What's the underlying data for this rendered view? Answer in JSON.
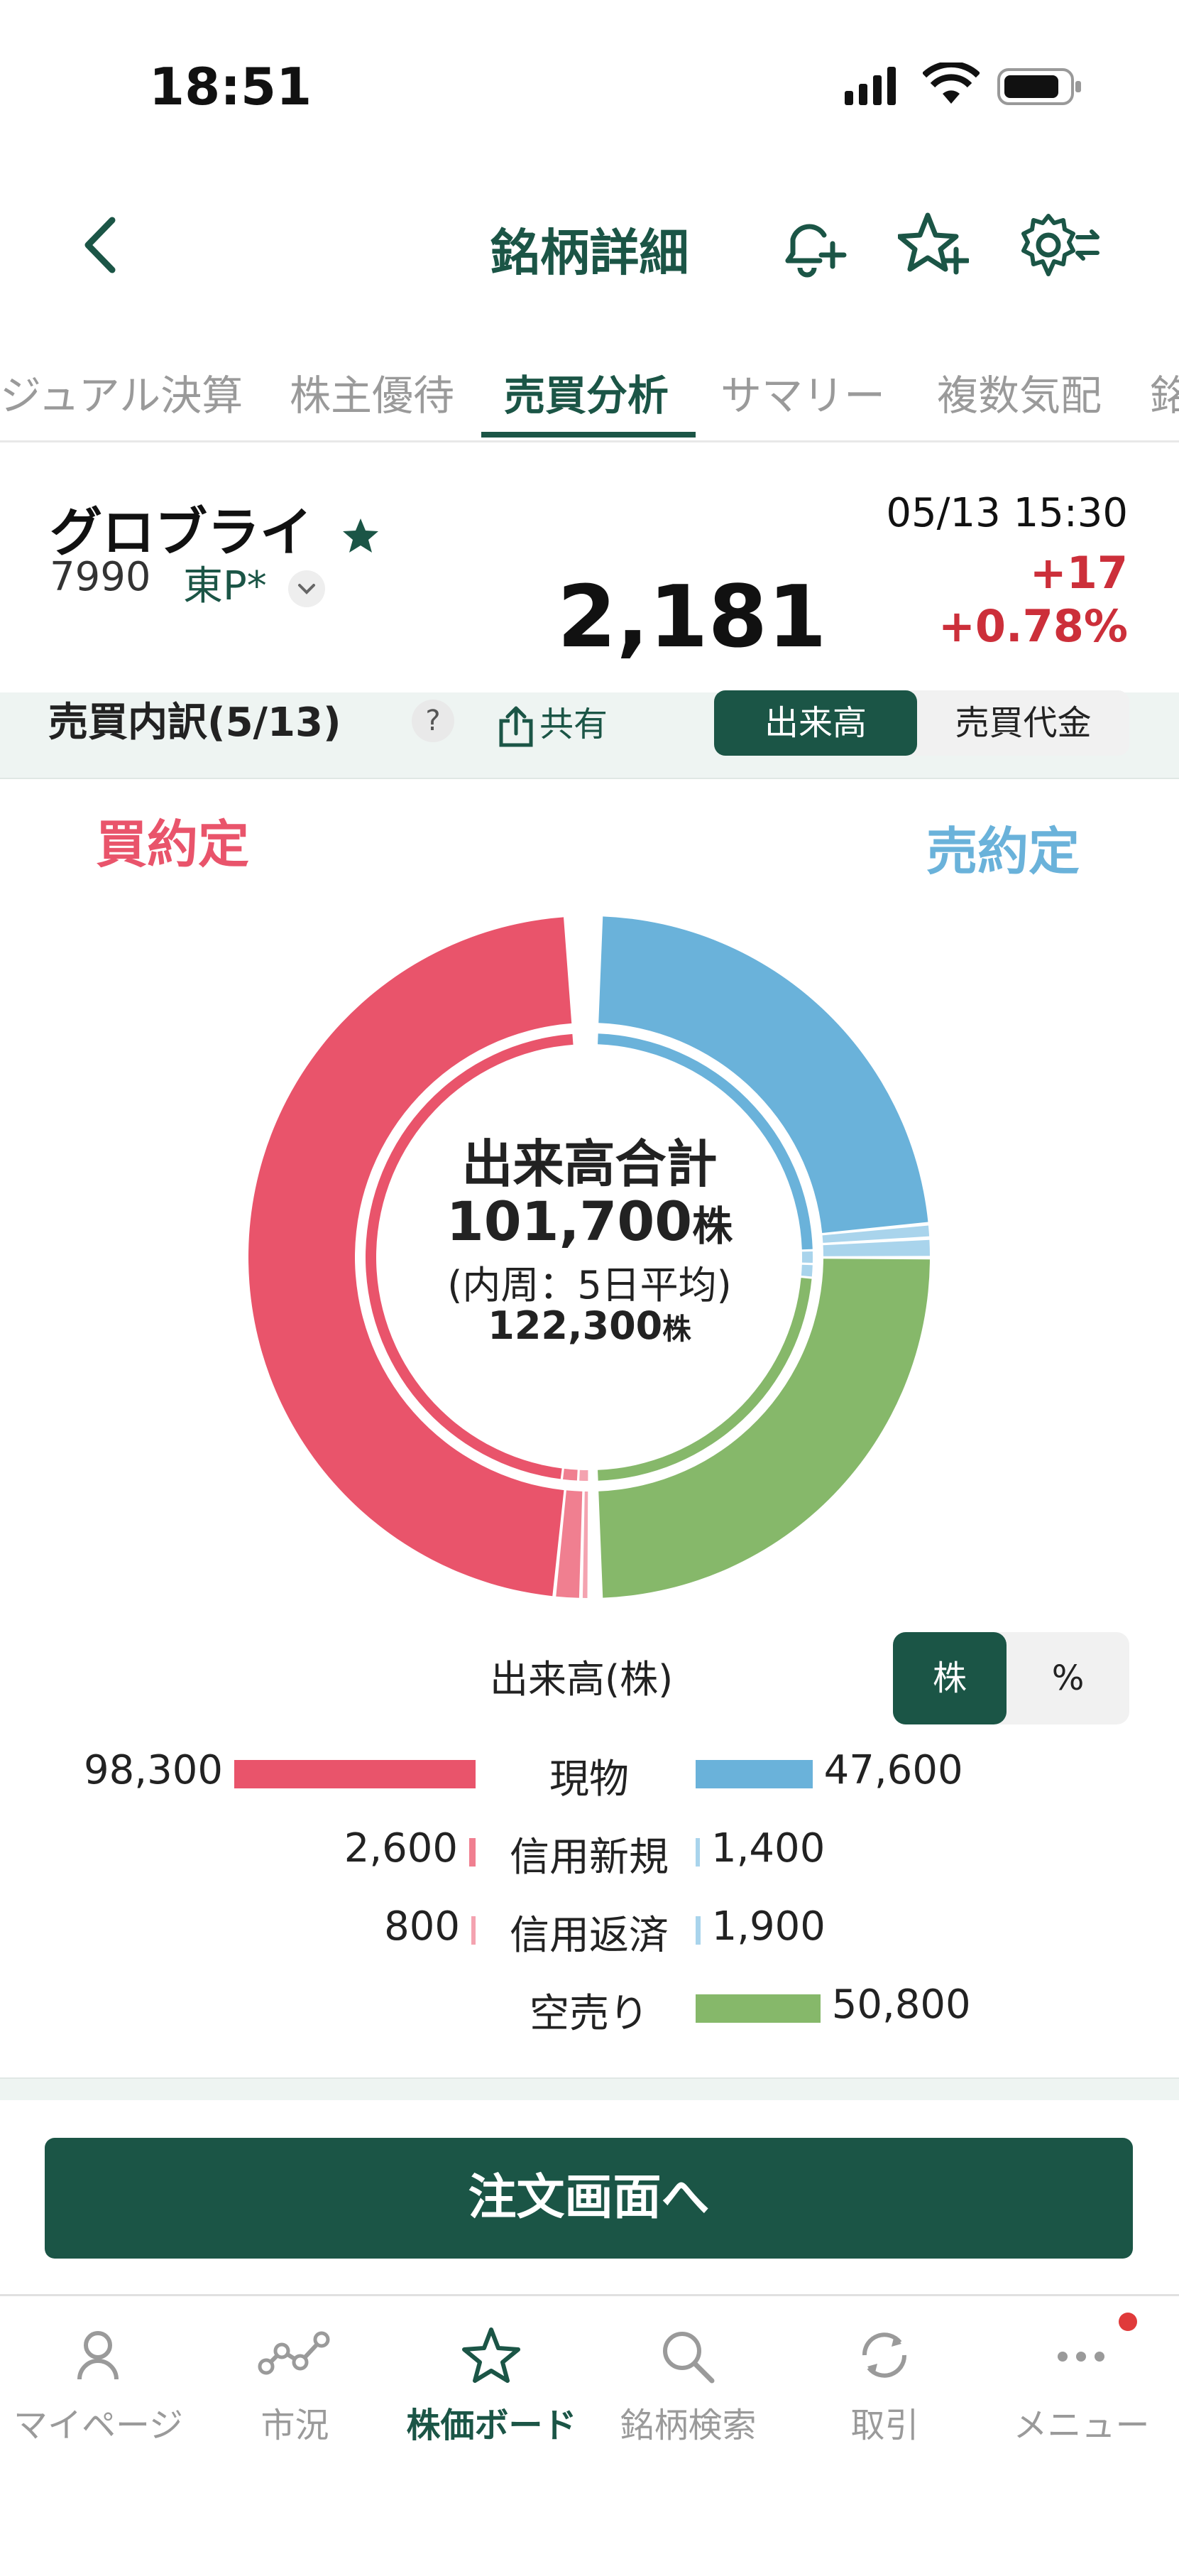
{
  "status_bar": {
    "time": "18:51"
  },
  "header": {
    "title": "銘柄詳細",
    "icons": [
      "back-chevron-icon",
      "bell-plus-icon",
      "star-plus-icon",
      "gear-swap-icon"
    ]
  },
  "tabs": [
    {
      "label": "ジュアル決算",
      "active": false
    },
    {
      "label": "株主優待",
      "active": false
    },
    {
      "label": "売買分析",
      "active": true
    },
    {
      "label": "サマリー",
      "active": false
    },
    {
      "label": "複数気配",
      "active": false
    },
    {
      "label": "銘",
      "active": false
    }
  ],
  "stock": {
    "name": "グロブライ",
    "code": "7990",
    "market": "東P*",
    "datetime": "05/13 15:30",
    "price": "2,181",
    "change": "+17",
    "change_pct": "+0.78%"
  },
  "section": {
    "title": "売買内訳(5/13)",
    "help": "?",
    "share": "共有",
    "toggle": [
      "出来高",
      "売買代金"
    ],
    "toggle_active": "出来高"
  },
  "chart_data": {
    "type": "pie",
    "buy_label": "買約定",
    "sell_label": "売約定",
    "center": {
      "title": "出来高合計",
      "total": "101,700",
      "unit": "株",
      "sub": "(内周：5日平均)",
      "avg": "122,300"
    },
    "outer_slices": [
      {
        "name": "現物",
        "side": "sell",
        "value": 47600,
        "color": "#6ab2da"
      },
      {
        "name": "信用新規",
        "side": "sell",
        "value": 1400,
        "color": "#a9d4ec"
      },
      {
        "name": "信用返済",
        "side": "sell",
        "value": 1900,
        "color": "#a9d4ec"
      },
      {
        "name": "空売り",
        "side": "sell",
        "value": 50800,
        "color": "#86b86a"
      },
      {
        "name": "信用返済",
        "side": "buy",
        "value": 800,
        "color": "#f4a3b0"
      },
      {
        "name": "信用新規",
        "side": "buy",
        "value": 2600,
        "color": "#f07f90"
      },
      {
        "name": "現物",
        "side": "buy",
        "value": 98300,
        "color": "#e9546b"
      }
    ]
  },
  "legend": {
    "title": "出来高(株)",
    "unit_toggle": [
      "株",
      "%"
    ],
    "unit_active": "株",
    "rows": [
      {
        "label": "現物",
        "buy": "98,300",
        "sell": "47,600",
        "buy_value": 98300,
        "sell_value": 47600
      },
      {
        "label": "信用新規",
        "buy": "2,600",
        "sell": "1,400",
        "buy_value": 2600,
        "sell_value": 1400
      },
      {
        "label": "信用返済",
        "buy": "800",
        "sell": "1,900",
        "buy_value": 800,
        "sell_value": 1900
      },
      {
        "label": "空売り",
        "buy": "",
        "sell": "50,800",
        "buy_value": 0,
        "sell_value": 50800
      }
    ]
  },
  "order_button": "注文画面へ",
  "bottom_nav": [
    {
      "label": "マイページ",
      "icon": "person-icon",
      "active": false
    },
    {
      "label": "市況",
      "icon": "chart-line-icon",
      "active": false
    },
    {
      "label": "株価ボード",
      "icon": "star-icon",
      "active": true
    },
    {
      "label": "銘柄検索",
      "icon": "search-icon",
      "active": false
    },
    {
      "label": "取引",
      "icon": "refresh-icon",
      "active": false
    },
    {
      "label": "メニュー",
      "icon": "more-icon",
      "active": false
    }
  ],
  "colors": {
    "brand": "#1b5546",
    "buy": "#e9546b",
    "sell": "#6ab2da",
    "short": "#86b86a",
    "down_red": "#cc2f3a"
  }
}
